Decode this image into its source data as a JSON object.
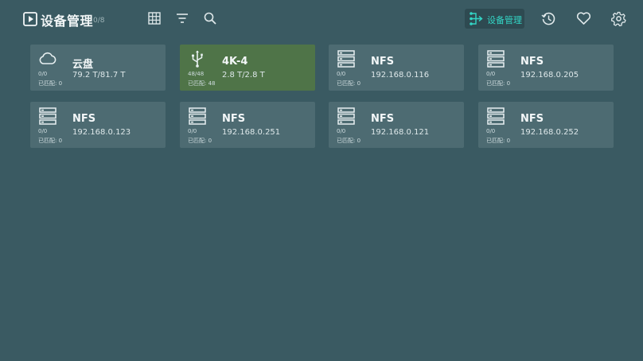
{
  "header": {
    "icon": "play-square-icon",
    "title": "设备管理",
    "count": "0/8",
    "toolbar": [
      {
        "name": "grid-view-icon"
      },
      {
        "name": "filter-icon"
      },
      {
        "name": "search-icon"
      }
    ],
    "manage_button": {
      "icon": "source-tree-icon",
      "label": "设备管理",
      "accent": "#33d6c6"
    },
    "right_icons": [
      {
        "name": "history-icon"
      },
      {
        "name": "favorite-heart-icon"
      },
      {
        "name": "settings-gear-icon"
      }
    ]
  },
  "devices": [
    {
      "icon": "cloud-icon",
      "name": "云盘",
      "detail": "79.2 T/81.7 T",
      "count": "0/0",
      "matched": "已匹配: 0",
      "selected": false
    },
    {
      "icon": "usb-icon",
      "name": "4K-4",
      "detail": "2.8 T/2.8 T",
      "count": "48/48",
      "matched": "已匹配: 48",
      "selected": true
    },
    {
      "icon": "server-icon",
      "name": "NFS",
      "detail": "192.168.0.116",
      "count": "0/0",
      "matched": "已匹配: 0",
      "selected": false
    },
    {
      "icon": "server-icon",
      "name": "NFS",
      "detail": "192.168.0.205",
      "count": "0/0",
      "matched": "已匹配: 0",
      "selected": false
    },
    {
      "icon": "server-icon",
      "name": "NFS",
      "detail": "192.168.0.123",
      "count": "0/0",
      "matched": "已匹配: 0",
      "selected": false
    },
    {
      "icon": "server-icon",
      "name": "NFS",
      "detail": "192.168.0.251",
      "count": "0/0",
      "matched": "已匹配: 0",
      "selected": false
    },
    {
      "icon": "server-icon",
      "name": "NFS",
      "detail": "192.168.0.121",
      "count": "0/0",
      "matched": "已匹配: 0",
      "selected": false
    },
    {
      "icon": "server-icon",
      "name": "NFS",
      "detail": "192.168.0.252",
      "count": "0/0",
      "matched": "已匹配: 0",
      "selected": false
    }
  ],
  "colors": {
    "background": "#3a5a62",
    "card": "#4d6b72",
    "card_selected": "#4f7448"
  }
}
